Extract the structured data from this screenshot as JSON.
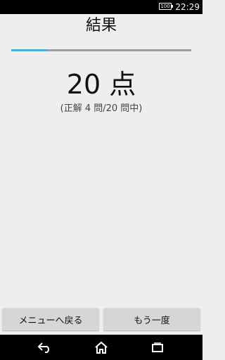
{
  "status_bar": {
    "battery_level": "100",
    "time": "22:29"
  },
  "screen": {
    "title": "結果",
    "progress": 0.2,
    "score": "20 点",
    "detail": "(正解 4 問/20 問中)"
  },
  "buttons": {
    "menu_label": "メニューへ戻る",
    "retry_label": "もう一度"
  },
  "nav_icons": [
    "back-icon",
    "home-icon",
    "recent-apps-icon"
  ],
  "colors": {
    "accent": "#33b5e5",
    "background": "#eeeeee",
    "button": "#d6d6d6"
  }
}
